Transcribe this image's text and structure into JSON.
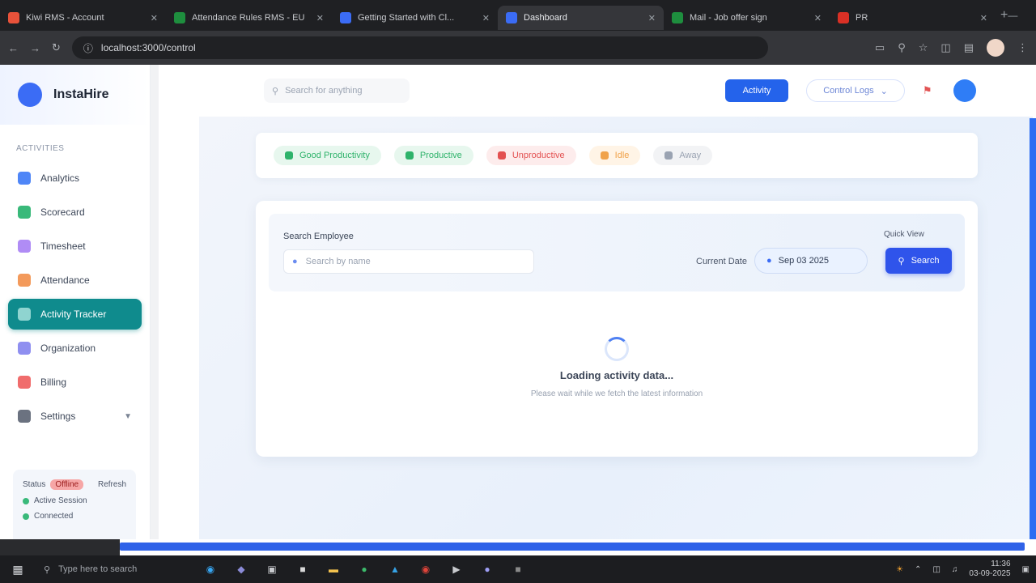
{
  "browser": {
    "tabs": [
      {
        "title": "Kiwi RMS - Account",
        "color": "#e8523a",
        "active": false
      },
      {
        "title": "Attendance Rules RMS - EU",
        "color": "#1e8e3e",
        "active": false
      },
      {
        "title": "Getting Started with Cl...",
        "color": "#3b6cf5",
        "active": false
      },
      {
        "title": "Dashboard",
        "color": "#3b6cf5",
        "active": true
      },
      {
        "title": "Mail - Job offer sign",
        "color": "#1e8e3e",
        "active": false
      },
      {
        "title": "PR",
        "color": "#d93025",
        "active": false
      }
    ],
    "new_tab": "+",
    "url": "localhost:3000/control"
  },
  "sidebar": {
    "brand": "InstaHire",
    "section": "Activities",
    "items": [
      {
        "label": "Analytics",
        "color": "#4f86f7",
        "active": false
      },
      {
        "label": "Scorecard",
        "color": "#39b97a",
        "active": false
      },
      {
        "label": "Timesheet",
        "color": "#b08cf5",
        "active": false
      },
      {
        "label": "Attendance",
        "color": "#f39a5b",
        "active": false
      },
      {
        "label": "Activity Tracker",
        "color": "#8fd4d0",
        "active": true
      },
      {
        "label": "Organization",
        "color": "#8f8ff0",
        "active": false
      },
      {
        "label": "Billing",
        "color": "#f06c6c",
        "active": false
      },
      {
        "label": "Settings",
        "color": "#6b7280",
        "active": false,
        "has_chevron": true
      }
    ],
    "status_card": {
      "label": "Status",
      "badge": "Offline",
      "trailing": "Refresh",
      "lines": [
        "Active Session",
        "Connected"
      ]
    }
  },
  "topbar": {
    "search_placeholder": "Search for anything",
    "primary_button": "Activity",
    "outline_button": "Control Logs"
  },
  "filters": [
    {
      "label": "Good Productivity",
      "bg": "#e7f7ee",
      "color": "#2fb36b"
    },
    {
      "label": "Productive",
      "bg": "#e7f7ee",
      "color": "#2fb36b"
    },
    {
      "label": "Unproductive",
      "bg": "#fdecec",
      "color": "#e35151"
    },
    {
      "label": "Idle",
      "bg": "#fff4e6",
      "color": "#f0a24a"
    },
    {
      "label": "Away",
      "bg": "#f2f3f5",
      "color": "#9aa3b2"
    }
  ],
  "panel": {
    "employee_label": "Search Employee",
    "employee_placeholder": "Search by name",
    "current_date_label": "Current Date",
    "date_value": "Sep 03 2025",
    "quick_label": "Quick View",
    "go_button": "Search"
  },
  "loading": {
    "title": "Loading activity data...",
    "subtitle": "Please wait while we fetch the latest information"
  },
  "taskbar": {
    "search_placeholder": "Type here to search",
    "time": "11:36",
    "date": "03-09-2025"
  }
}
